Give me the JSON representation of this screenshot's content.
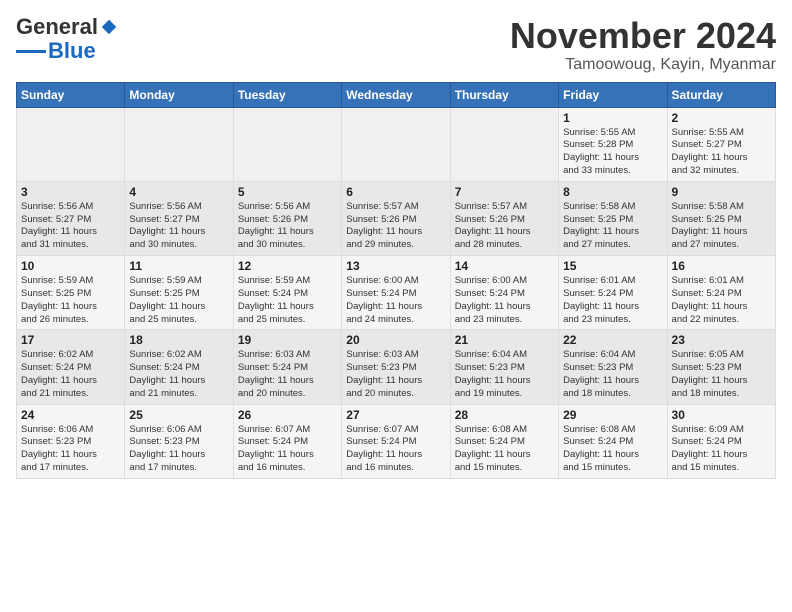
{
  "logo": {
    "general": "General",
    "blue": "Blue"
  },
  "header": {
    "month": "November 2024",
    "location": "Tamoowoug, Kayin, Myanmar"
  },
  "weekdays": [
    "Sunday",
    "Monday",
    "Tuesday",
    "Wednesday",
    "Thursday",
    "Friday",
    "Saturday"
  ],
  "weeks": [
    [
      {
        "day": "",
        "info": ""
      },
      {
        "day": "",
        "info": ""
      },
      {
        "day": "",
        "info": ""
      },
      {
        "day": "",
        "info": ""
      },
      {
        "day": "",
        "info": ""
      },
      {
        "day": "1",
        "info": "Sunrise: 5:55 AM\nSunset: 5:28 PM\nDaylight: 11 hours\nand 33 minutes."
      },
      {
        "day": "2",
        "info": "Sunrise: 5:55 AM\nSunset: 5:27 PM\nDaylight: 11 hours\nand 32 minutes."
      }
    ],
    [
      {
        "day": "3",
        "info": "Sunrise: 5:56 AM\nSunset: 5:27 PM\nDaylight: 11 hours\nand 31 minutes."
      },
      {
        "day": "4",
        "info": "Sunrise: 5:56 AM\nSunset: 5:27 PM\nDaylight: 11 hours\nand 30 minutes."
      },
      {
        "day": "5",
        "info": "Sunrise: 5:56 AM\nSunset: 5:26 PM\nDaylight: 11 hours\nand 30 minutes."
      },
      {
        "day": "6",
        "info": "Sunrise: 5:57 AM\nSunset: 5:26 PM\nDaylight: 11 hours\nand 29 minutes."
      },
      {
        "day": "7",
        "info": "Sunrise: 5:57 AM\nSunset: 5:26 PM\nDaylight: 11 hours\nand 28 minutes."
      },
      {
        "day": "8",
        "info": "Sunrise: 5:58 AM\nSunset: 5:25 PM\nDaylight: 11 hours\nand 27 minutes."
      },
      {
        "day": "9",
        "info": "Sunrise: 5:58 AM\nSunset: 5:25 PM\nDaylight: 11 hours\nand 27 minutes."
      }
    ],
    [
      {
        "day": "10",
        "info": "Sunrise: 5:59 AM\nSunset: 5:25 PM\nDaylight: 11 hours\nand 26 minutes."
      },
      {
        "day": "11",
        "info": "Sunrise: 5:59 AM\nSunset: 5:25 PM\nDaylight: 11 hours\nand 25 minutes."
      },
      {
        "day": "12",
        "info": "Sunrise: 5:59 AM\nSunset: 5:24 PM\nDaylight: 11 hours\nand 25 minutes."
      },
      {
        "day": "13",
        "info": "Sunrise: 6:00 AM\nSunset: 5:24 PM\nDaylight: 11 hours\nand 24 minutes."
      },
      {
        "day": "14",
        "info": "Sunrise: 6:00 AM\nSunset: 5:24 PM\nDaylight: 11 hours\nand 23 minutes."
      },
      {
        "day": "15",
        "info": "Sunrise: 6:01 AM\nSunset: 5:24 PM\nDaylight: 11 hours\nand 23 minutes."
      },
      {
        "day": "16",
        "info": "Sunrise: 6:01 AM\nSunset: 5:24 PM\nDaylight: 11 hours\nand 22 minutes."
      }
    ],
    [
      {
        "day": "17",
        "info": "Sunrise: 6:02 AM\nSunset: 5:24 PM\nDaylight: 11 hours\nand 21 minutes."
      },
      {
        "day": "18",
        "info": "Sunrise: 6:02 AM\nSunset: 5:24 PM\nDaylight: 11 hours\nand 21 minutes."
      },
      {
        "day": "19",
        "info": "Sunrise: 6:03 AM\nSunset: 5:24 PM\nDaylight: 11 hours\nand 20 minutes."
      },
      {
        "day": "20",
        "info": "Sunrise: 6:03 AM\nSunset: 5:23 PM\nDaylight: 11 hours\nand 20 minutes."
      },
      {
        "day": "21",
        "info": "Sunrise: 6:04 AM\nSunset: 5:23 PM\nDaylight: 11 hours\nand 19 minutes."
      },
      {
        "day": "22",
        "info": "Sunrise: 6:04 AM\nSunset: 5:23 PM\nDaylight: 11 hours\nand 18 minutes."
      },
      {
        "day": "23",
        "info": "Sunrise: 6:05 AM\nSunset: 5:23 PM\nDaylight: 11 hours\nand 18 minutes."
      }
    ],
    [
      {
        "day": "24",
        "info": "Sunrise: 6:06 AM\nSunset: 5:23 PM\nDaylight: 11 hours\nand 17 minutes."
      },
      {
        "day": "25",
        "info": "Sunrise: 6:06 AM\nSunset: 5:23 PM\nDaylight: 11 hours\nand 17 minutes."
      },
      {
        "day": "26",
        "info": "Sunrise: 6:07 AM\nSunset: 5:24 PM\nDaylight: 11 hours\nand 16 minutes."
      },
      {
        "day": "27",
        "info": "Sunrise: 6:07 AM\nSunset: 5:24 PM\nDaylight: 11 hours\nand 16 minutes."
      },
      {
        "day": "28",
        "info": "Sunrise: 6:08 AM\nSunset: 5:24 PM\nDaylight: 11 hours\nand 15 minutes."
      },
      {
        "day": "29",
        "info": "Sunrise: 6:08 AM\nSunset: 5:24 PM\nDaylight: 11 hours\nand 15 minutes."
      },
      {
        "day": "30",
        "info": "Sunrise: 6:09 AM\nSunset: 5:24 PM\nDaylight: 11 hours\nand 15 minutes."
      }
    ]
  ]
}
